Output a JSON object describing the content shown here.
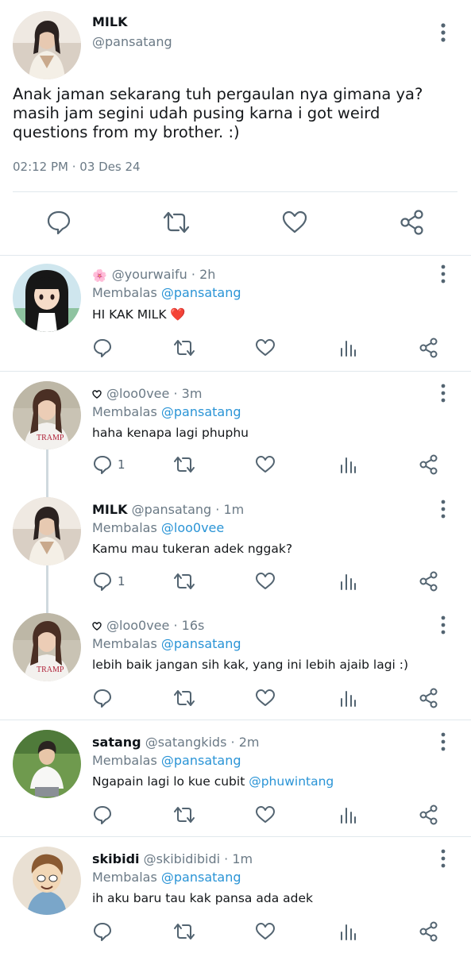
{
  "colors": {
    "text": "#0f1419",
    "muted": "#6b7a86",
    "link": "#2a94d6",
    "icon": "#536471",
    "divider": "#e1e8ed",
    "heart_emoji": "#e0245e"
  },
  "main": {
    "name": "MILK",
    "handle": "@pansatang",
    "text": "Anak jaman sekarang tuh pergaulan nya gimana ya? masih jam segini udah pusing karna i got weird questions from my brother. :)",
    "timestamp": "02:12 PM · 03 Des 24",
    "actions": [
      "comment-icon",
      "retweet-icon",
      "like-icon",
      "share-icon"
    ]
  },
  "replies": [
    {
      "badge": "🌸",
      "name": "",
      "handle": "@yourwaifu",
      "time": "2h",
      "replying_label": "Membalas",
      "replying_to": "@pansatang",
      "text": "HI KAK MILK",
      "emoji": "❤️",
      "reply_count": ""
    },
    {
      "badge": "heart-outline-badge",
      "name": "",
      "handle": "@loo0vee",
      "time": "3m",
      "replying_label": "Membalas",
      "replying_to": "@pansatang",
      "text": "haha kenapa lagi phuphu",
      "reply_count": "1"
    },
    {
      "badge": "",
      "name": "MILK",
      "handle": "@pansatang",
      "time": "1m",
      "replying_label": "Membalas",
      "replying_to": "@loo0vee",
      "text": "Kamu mau tukeran adek nggak?",
      "reply_count": "1"
    },
    {
      "badge": "heart-outline-badge",
      "name": "",
      "handle": "@loo0vee",
      "time": "16s",
      "replying_label": "Membalas",
      "replying_to": "@pansatang",
      "text": "lebih baik jangan sih kak, yang ini lebih ajaib lagi :)",
      "reply_count": ""
    },
    {
      "badge": "",
      "name": "satang",
      "handle": "@satangkids",
      "time": "2m",
      "replying_label": "Membalas",
      "replying_to": "@pansatang",
      "text": "Ngapain lagi lo kue cubit",
      "mention": "@phuwintang",
      "reply_count": ""
    },
    {
      "badge": "",
      "name": "skibidi",
      "handle": "@skibidibidi",
      "time": "1m",
      "replying_label": "Membalas",
      "replying_to": "@pansatang",
      "text": "ih aku baru tau kak pansa ada adek",
      "reply_count": ""
    }
  ],
  "dot": "·"
}
